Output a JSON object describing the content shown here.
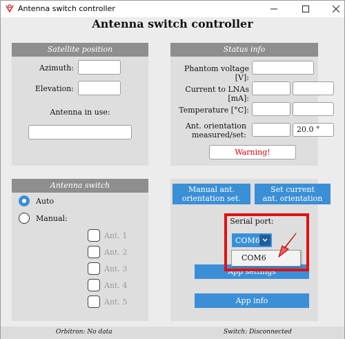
{
  "window": {
    "title": "Antenna switch controller"
  },
  "app_title": "Antenna switch controller",
  "satellite_position": {
    "header": "Satellite position",
    "azimuth_label": "Azimuth:",
    "azimuth_value": "",
    "elevation_label": "Elevation:",
    "elevation_value": "",
    "antenna_in_use_label": "Antenna in use:",
    "antenna_in_use_value": ""
  },
  "status_info": {
    "header": "Status info",
    "phantom_voltage_label": "Phantom voltage [V]:",
    "phantom_voltage_value": "",
    "current_lna_label": "Current to LNAs [mA]:",
    "current_lna_value_1": "",
    "current_lna_value_2": "",
    "temperature_label": "Temperature [°C]:",
    "temperature_value_1": "",
    "temperature_value_2": "",
    "orientation_label_line1": "Ant. orientation",
    "orientation_label_line2": "measured/set:",
    "orientation_measured": "",
    "orientation_set": "20.0 °",
    "warning": "Warning!"
  },
  "antenna_switch": {
    "header": "Antenna switch",
    "auto_label": "Auto",
    "auto_selected": true,
    "manual_label": "Manual:",
    "antennas": [
      "Ant. 1",
      "Ant. 2",
      "Ant. 3",
      "Ant. 4",
      "Ant. 5"
    ]
  },
  "controls": {
    "manual_orientation_line1": "Manual ant.",
    "manual_orientation_line2": "orientation set.",
    "set_current_line1": "Set current",
    "set_current_line2": "ant. orientation",
    "serial_port_label": "Serial port:",
    "serial_port_value": "COM6",
    "serial_port_options": [
      "COM6"
    ],
    "app_settings": "App settings",
    "app_info": "App info"
  },
  "statusbar": {
    "orbitron": "Orbitron: No data",
    "switch": "Switch: Disconnected"
  },
  "colors": {
    "accent": "#3b8fd6",
    "panel_header": "#8e8e8e",
    "warning": "#dd0000",
    "highlight": "#e01010"
  }
}
